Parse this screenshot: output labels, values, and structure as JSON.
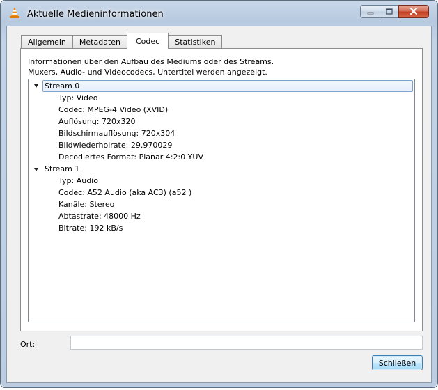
{
  "window": {
    "title": "Aktuelle Medieninformationen",
    "app_icon": "vlc-cone-icon",
    "accent_color": "#c33e21"
  },
  "caption_buttons": {
    "minimize_icon": "minimize-icon",
    "maximize_icon": "maximize-icon",
    "close_icon": "close-icon"
  },
  "tabs": [
    {
      "label": "Allgemein",
      "active": false
    },
    {
      "label": "Metadaten",
      "active": false
    },
    {
      "label": "Codec",
      "active": true
    },
    {
      "label": "Statistiken",
      "active": false
    }
  ],
  "codec_panel": {
    "description_line1": "Informationen über den Aufbau des Mediums oder des Streams.",
    "description_line2": "Muxers, Audio- und Videocodecs, Untertitel werden angezeigt.",
    "streams": [
      {
        "label": "Stream 0",
        "expanded": true,
        "selected": true,
        "items": [
          "Typ: Video",
          "Codec: MPEG-4 Video (XVID)",
          "Auflösung: 720x320",
          "Bildschirmauflösung: 720x304",
          "Bildwiederholrate: 29.970029",
          "Decodiertes Format: Planar 4:2:0 YUV"
        ]
      },
      {
        "label": "Stream 1",
        "expanded": true,
        "selected": false,
        "items": [
          "Typ: Audio",
          "Codec: A52 Audio (aka AC3) (a52 )",
          "Kanäle: Stereo",
          "Abtastrate: 48000 Hz",
          "Bitrate: 192 kB/s"
        ]
      }
    ]
  },
  "location": {
    "label": "Ort:",
    "value": "",
    "placeholder": ""
  },
  "footer": {
    "close_label": "Schließen"
  }
}
